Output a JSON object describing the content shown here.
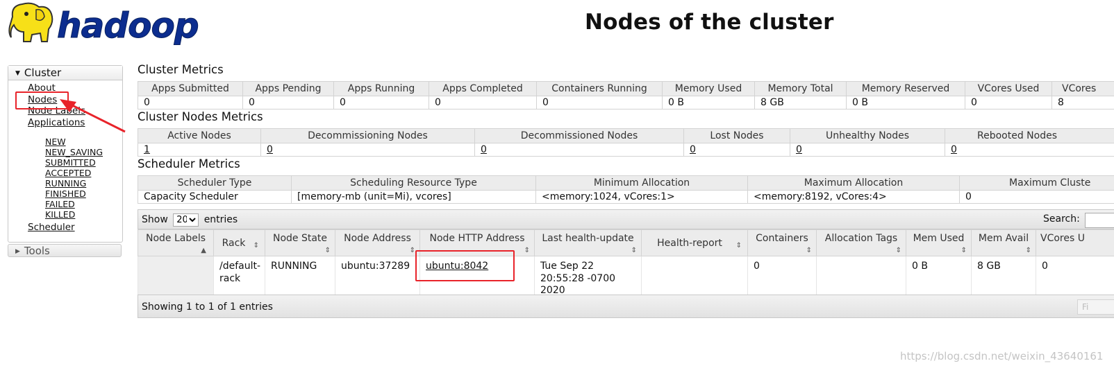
{
  "header": {
    "logo_text": "hadoop",
    "title": "Nodes of the cluster"
  },
  "sidebar": {
    "cluster_label": "Cluster",
    "links": [
      {
        "label": "About"
      },
      {
        "label": "Nodes"
      },
      {
        "label": "Node Labels"
      },
      {
        "label": "Applications"
      }
    ],
    "app_states": [
      "NEW",
      "NEW_SAVING",
      "SUBMITTED",
      "ACCEPTED",
      "RUNNING",
      "FINISHED",
      "FAILED",
      "KILLED"
    ],
    "scheduler_label": "Scheduler",
    "tools_label": "Tools"
  },
  "cluster_metrics": {
    "title": "Cluster Metrics",
    "headers": [
      "Apps Submitted",
      "Apps Pending",
      "Apps Running",
      "Apps Completed",
      "Containers Running",
      "Memory Used",
      "Memory Total",
      "Memory Reserved",
      "VCores Used",
      "VCores"
    ],
    "values": [
      "0",
      "0",
      "0",
      "0",
      "0",
      "0 B",
      "8 GB",
      "0 B",
      "0",
      "8"
    ]
  },
  "nodes_metrics": {
    "title": "Cluster Nodes Metrics",
    "headers": [
      "Active Nodes",
      "Decommissioning Nodes",
      "Decommissioned Nodes",
      "Lost Nodes",
      "Unhealthy Nodes",
      "Rebooted Nodes"
    ],
    "values": [
      "1",
      "0",
      "0",
      "0",
      "0",
      "0"
    ]
  },
  "scheduler_metrics": {
    "title": "Scheduler Metrics",
    "headers": [
      "Scheduler Type",
      "Scheduling Resource Type",
      "Minimum Allocation",
      "Maximum Allocation",
      "Maximum Cluste"
    ],
    "values": [
      "Capacity Scheduler",
      "[memory-mb (unit=Mi), vcores]",
      "<memory:1024, vCores:1>",
      "<memory:8192, vCores:4>",
      "0"
    ]
  },
  "nodes_table": {
    "show_label": "Show",
    "page_size": "20",
    "entries_label": "entries",
    "search_label": "Search:",
    "columns": [
      "Node Labels",
      "Rack",
      "Node State",
      "Node Address",
      "Node HTTP Address",
      "Last health-update",
      "Health-report",
      "Containers",
      "Allocation Tags",
      "Mem Used",
      "Mem Avail",
      "VCores U"
    ],
    "row": {
      "node_labels": "",
      "rack": "/default-rack",
      "state": "RUNNING",
      "address": "ubuntu:37289",
      "http_address": "ubuntu:8042",
      "last_health_update": "Tue Sep 22 20:55:28 -0700 2020",
      "health_report": "",
      "containers": "0",
      "allocation_tags": "",
      "mem_used": "0 B",
      "mem_avail": "8 GB",
      "vcores_used": "0"
    },
    "info": "Showing 1 to 1 of 1 entries",
    "first_button": "Fi"
  },
  "watermark": "https://blog.csdn.net/weixin_43640161",
  "colors": {
    "annotation_red": "#e8232a",
    "logo_yellow": "#f7e018",
    "logo_blue": "#0c2d8f"
  }
}
